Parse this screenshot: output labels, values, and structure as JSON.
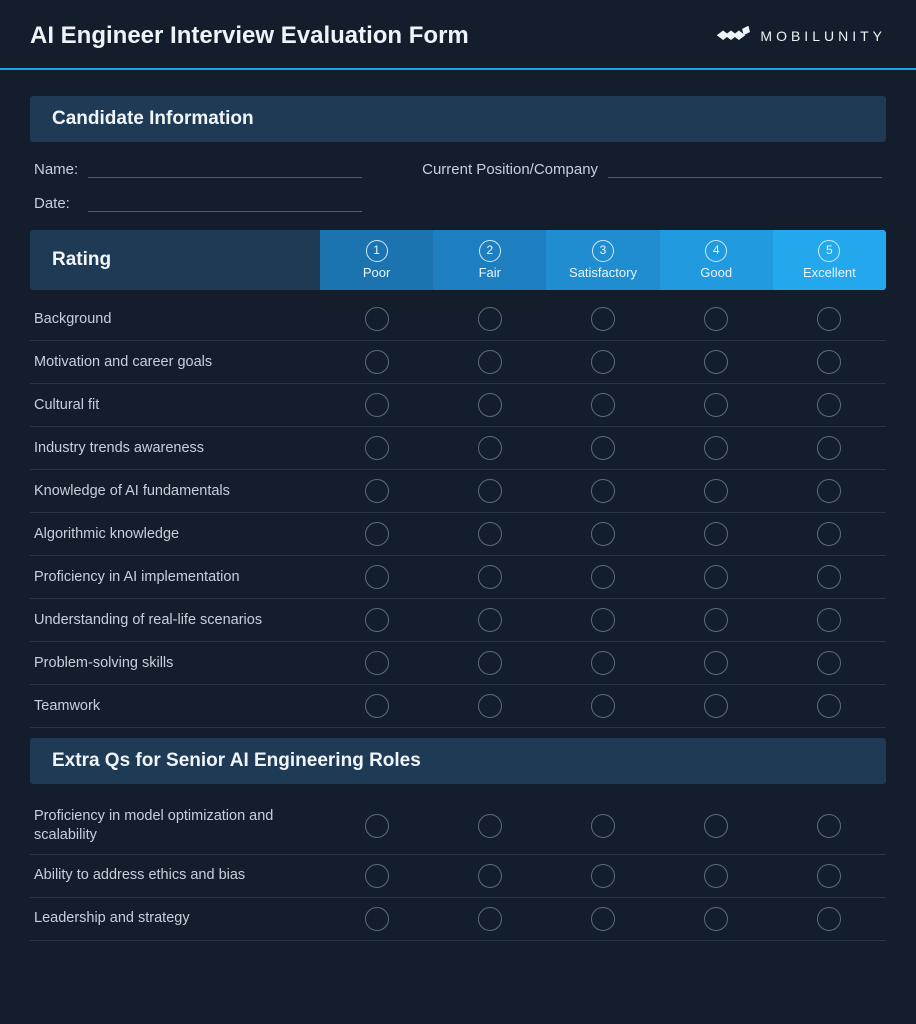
{
  "header": {
    "title": "AI Engineer Interview Evaluation Form",
    "brand": "MOBILUNITY"
  },
  "sections": {
    "candidate_info": {
      "title": "Candidate Information",
      "fields": {
        "name_label": "Name:",
        "position_label": "Current Position/Company",
        "date_label": "Date:"
      }
    },
    "rating": {
      "title": "Rating",
      "scale": [
        {
          "num": "1",
          "label": "Poor"
        },
        {
          "num": "2",
          "label": "Fair"
        },
        {
          "num": "3",
          "label": "Satisfactory"
        },
        {
          "num": "4",
          "label": "Good"
        },
        {
          "num": "5",
          "label": "Excellent"
        }
      ],
      "criteria": [
        "Background",
        "Motivation and career goals",
        "Cultural fit",
        "Industry trends awareness",
        "Knowledge of AI fundamentals",
        "Algorithmic knowledge",
        "Proficiency in AI implementation",
        "Understanding of real-life scenarios",
        "Problem-solving skills",
        "Teamwork"
      ]
    },
    "senior": {
      "title": "Extra Qs for Senior AI Engineering Roles",
      "criteria": [
        "Proficiency in model optimization and scalability",
        "Ability to address ethics and bias",
        "Leadership and strategy"
      ]
    }
  }
}
